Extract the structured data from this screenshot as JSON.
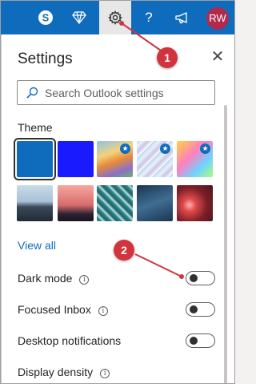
{
  "topbar": {
    "icons": [
      "skype-icon",
      "diamond-icon",
      "gear-icon",
      "help-icon",
      "megaphone-icon"
    ],
    "avatar_initials": "RW",
    "brand_color": "#0f6cbd"
  },
  "settings": {
    "title": "Settings",
    "search_placeholder": "Search Outlook settings",
    "theme_title": "Theme",
    "view_all": "View all",
    "toggles": [
      {
        "label": "Dark mode",
        "state": "off"
      },
      {
        "label": "Focused Inbox",
        "state": "off"
      },
      {
        "label": "Desktop notifications",
        "state": "off"
      }
    ],
    "display_density": "Display density"
  },
  "callouts": {
    "one": "1",
    "two": "2"
  },
  "colors": {
    "callout": "#d1343c",
    "link": "#0f6cbd"
  }
}
